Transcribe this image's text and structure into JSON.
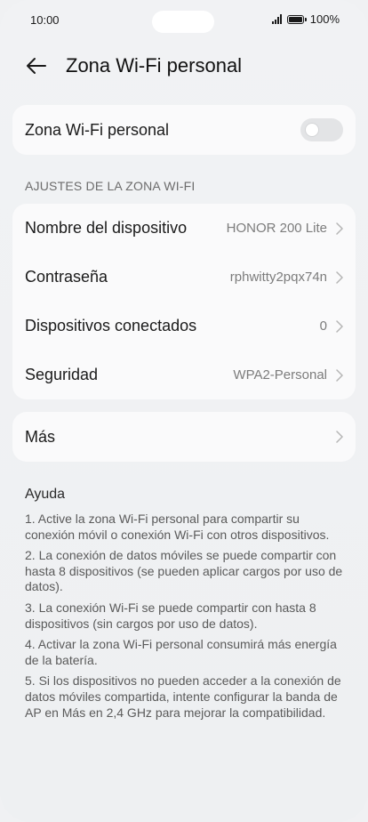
{
  "status_bar": {
    "time": "10:00",
    "battery": "100%"
  },
  "header": {
    "title": "Zona Wi-Fi personal"
  },
  "hotspot_toggle": {
    "label": "Zona Wi-Fi personal",
    "enabled": false
  },
  "section_header": "AJUSTES DE LA ZONA WI-FI",
  "settings": [
    {
      "label": "Nombre del dispositivo",
      "value": "HONOR 200 Lite"
    },
    {
      "label": "Contraseña",
      "value": "rphwitty2pqx74n"
    },
    {
      "label": "Dispositivos conectados",
      "value": "0"
    },
    {
      "label": "Seguridad",
      "value": "WPA2-Personal"
    }
  ],
  "more": {
    "label": "Más"
  },
  "help": {
    "title": "Ayuda",
    "items": [
      "1. Active la zona Wi-Fi personal para compartir su conexión móvil o conexión Wi-Fi con otros dispositivos.",
      "2. La conexión de datos móviles se puede compartir con hasta 8 dispositivos (se pueden aplicar cargos por uso de datos).",
      "3. La conexión Wi-Fi se puede compartir con hasta 8 dispositivos (sin cargos por uso de datos).",
      "4. Activar la zona Wi-Fi personal consumirá más energía de la batería.",
      "5. Si los dispositivos no pueden acceder a la conexión de datos móviles compartida, intente configurar la banda de AP en Más en 2,4 GHz para mejorar la compatibilidad."
    ]
  }
}
